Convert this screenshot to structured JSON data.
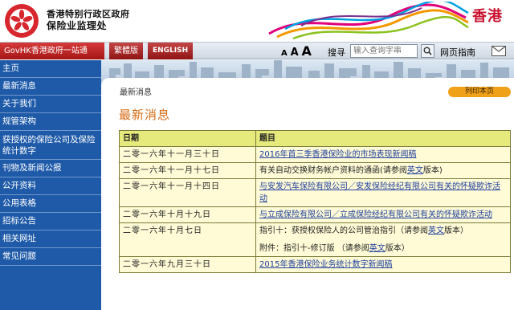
{
  "header": {
    "org_line1": "香港特别行政区政府",
    "org_line2": "保险业监理处",
    "brand": "香港"
  },
  "navbar": {
    "govhk": "GovHK香港政府一站通",
    "lang_traditional": "繁體版",
    "lang_english": "ENGLISH",
    "font_small": "A",
    "font_medium": "A",
    "font_large": "A",
    "search_label": "搜寻",
    "search_placeholder": "输入查询字串",
    "sitemap": "网页指南"
  },
  "sidebar": {
    "items": [
      {
        "label": "主页"
      },
      {
        "label": "最新消息"
      },
      {
        "label": "关于我们"
      },
      {
        "label": "规管架构"
      },
      {
        "label": "获授权的保险公司及保险统计数字"
      },
      {
        "label": "刊物及新闻公报"
      },
      {
        "label": "公开资料"
      },
      {
        "label": "公用表格"
      },
      {
        "label": "招标公告"
      },
      {
        "label": "相关网址"
      },
      {
        "label": "常见问题"
      }
    ]
  },
  "content": {
    "breadcrumb": "最新消息",
    "print_label": "列印本页",
    "title": "最新消息"
  },
  "table": {
    "headers": [
      "日期",
      "题目"
    ],
    "rows": [
      {
        "date": "二零一六年十一月三十日",
        "title_parts": [
          {
            "text": "2016年首三季香港保险业的市场表现新闻稿",
            "link": true
          }
        ]
      },
      {
        "date": "二零一六年十一月十七日",
        "title_parts": [
          {
            "text": "有关自动交换财务帐户资料的通函(请参阅",
            "link": false
          },
          {
            "text": "英文",
            "link": true
          },
          {
            "text": "版本)",
            "link": false
          }
        ]
      },
      {
        "date": "二零一六年十一月十四日",
        "title_parts": [
          {
            "text": "与安发汽车保险有限公司／安发保险经纪有限公司有关的怀疑欺诈活动",
            "link": true
          }
        ]
      },
      {
        "date": "二零一六年十月十九日",
        "title_parts": [
          {
            "text": "与立成保险有限公司／立成保险经纪有限公司有关的怀疑欺诈活动",
            "link": true
          }
        ]
      },
      {
        "date": "二零一六年十月七日",
        "title_parts": [
          {
            "text": "指引十：获授权保险人的公司管治指引（请参阅",
            "link": false
          },
          {
            "text": "英文",
            "link": true
          },
          {
            "text": "版本）",
            "link": false
          }
        ],
        "extra_parts": [
          {
            "text": "附件：指引十-修订版 （请参阅",
            "link": false
          },
          {
            "text": "英文",
            "link": true
          },
          {
            "text": "版本）",
            "link": false
          }
        ]
      },
      {
        "date": "二零一六年九月三十日",
        "title_parts": [
          {
            "text": "2015年香港保险业务统计数字新闻稿",
            "link": true
          }
        ]
      }
    ]
  },
  "colors": {
    "sidebar_bg": "#1e5aa8",
    "govhk_red": "#c8102e",
    "title_orange": "#d86a12",
    "table_header": "#e6ea7c",
    "table_cell": "#fffbd6",
    "link": "#1f3f9f"
  }
}
